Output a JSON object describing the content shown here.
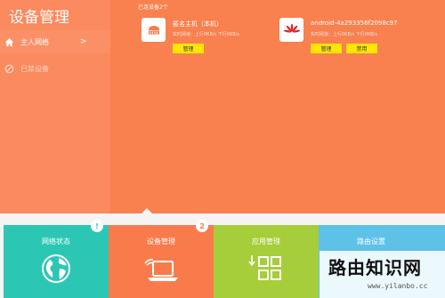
{
  "sidebar": {
    "title": "设备管理",
    "items": [
      {
        "label": "主人网络",
        "chevron": ">"
      },
      {
        "label": "已禁设备"
      }
    ]
  },
  "main": {
    "count_text": "已连设备2个",
    "devices": [
      {
        "name": "匿名主机（本机）",
        "speed": "实时网速：上行0KB/s 下行0KB/s",
        "icon": "host-computer-icon",
        "buttons": [
          "管理"
        ]
      },
      {
        "name": "android-4a293356f2098c97",
        "speed": "实时网速：上行0KB/s 下行0KB/s",
        "icon": "huawei-logo-icon",
        "buttons": [
          "管理",
          "禁用"
        ]
      }
    ]
  },
  "dock": {
    "tiles": [
      {
        "label": "网络状态",
        "color": "#2bc7b4",
        "badge": "!",
        "icon": "globe-icon"
      },
      {
        "label": "设备管理",
        "color": "#f97b4c",
        "badge": "2",
        "icon": "laptop-wifi-icon"
      },
      {
        "label": "应用管理",
        "color": "#a6cd3a",
        "icon": "apps-grid-icon"
      },
      {
        "label": "路由设置",
        "color": "#5ec1e8",
        "icon": "router-icon"
      }
    ]
  },
  "watermark": {
    "title": "路由知识网",
    "url": "www.yilanbo.cc"
  }
}
